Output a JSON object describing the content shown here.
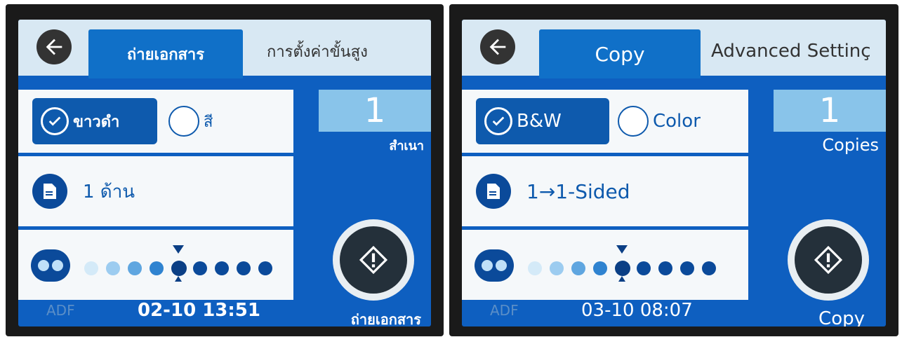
{
  "left": {
    "tab_copy": "ถ่ายเอกสาร",
    "tab_advanced": "การตั้งค่าขั้นสูง",
    "bw_label": "ขาวดำ",
    "color_label": "สี",
    "sided_label": "1 ด้าน",
    "copies_value": "1",
    "copies_label": "สำเนา",
    "start_label": "ถ่ายเอกสาร",
    "adf": "ADF",
    "datetime": "02-10 13:51",
    "density_level": 5,
    "density_levels": 9
  },
  "right": {
    "tab_copy": "Copy",
    "tab_advanced": "Advanced Settinç",
    "bw_label": "B&W",
    "color_label": "Color",
    "sided_label": "1→1-Sided",
    "copies_value": "1",
    "copies_label": "Copies",
    "start_label": "Copy",
    "adf": "ADF",
    "datetime": "03-10 08:07",
    "density_level": 5,
    "density_levels": 9
  },
  "icons": {
    "back": "back-arrow-icon",
    "check": "checkmark-icon",
    "document": "document-icon",
    "density": "density-icon",
    "start": "start-copy-icon"
  },
  "colors": {
    "screen_blue": "#0e5fc0",
    "button_blue": "#0e5aad",
    "copies_box": "#89c4ea",
    "panel": "#f5f8fa"
  }
}
